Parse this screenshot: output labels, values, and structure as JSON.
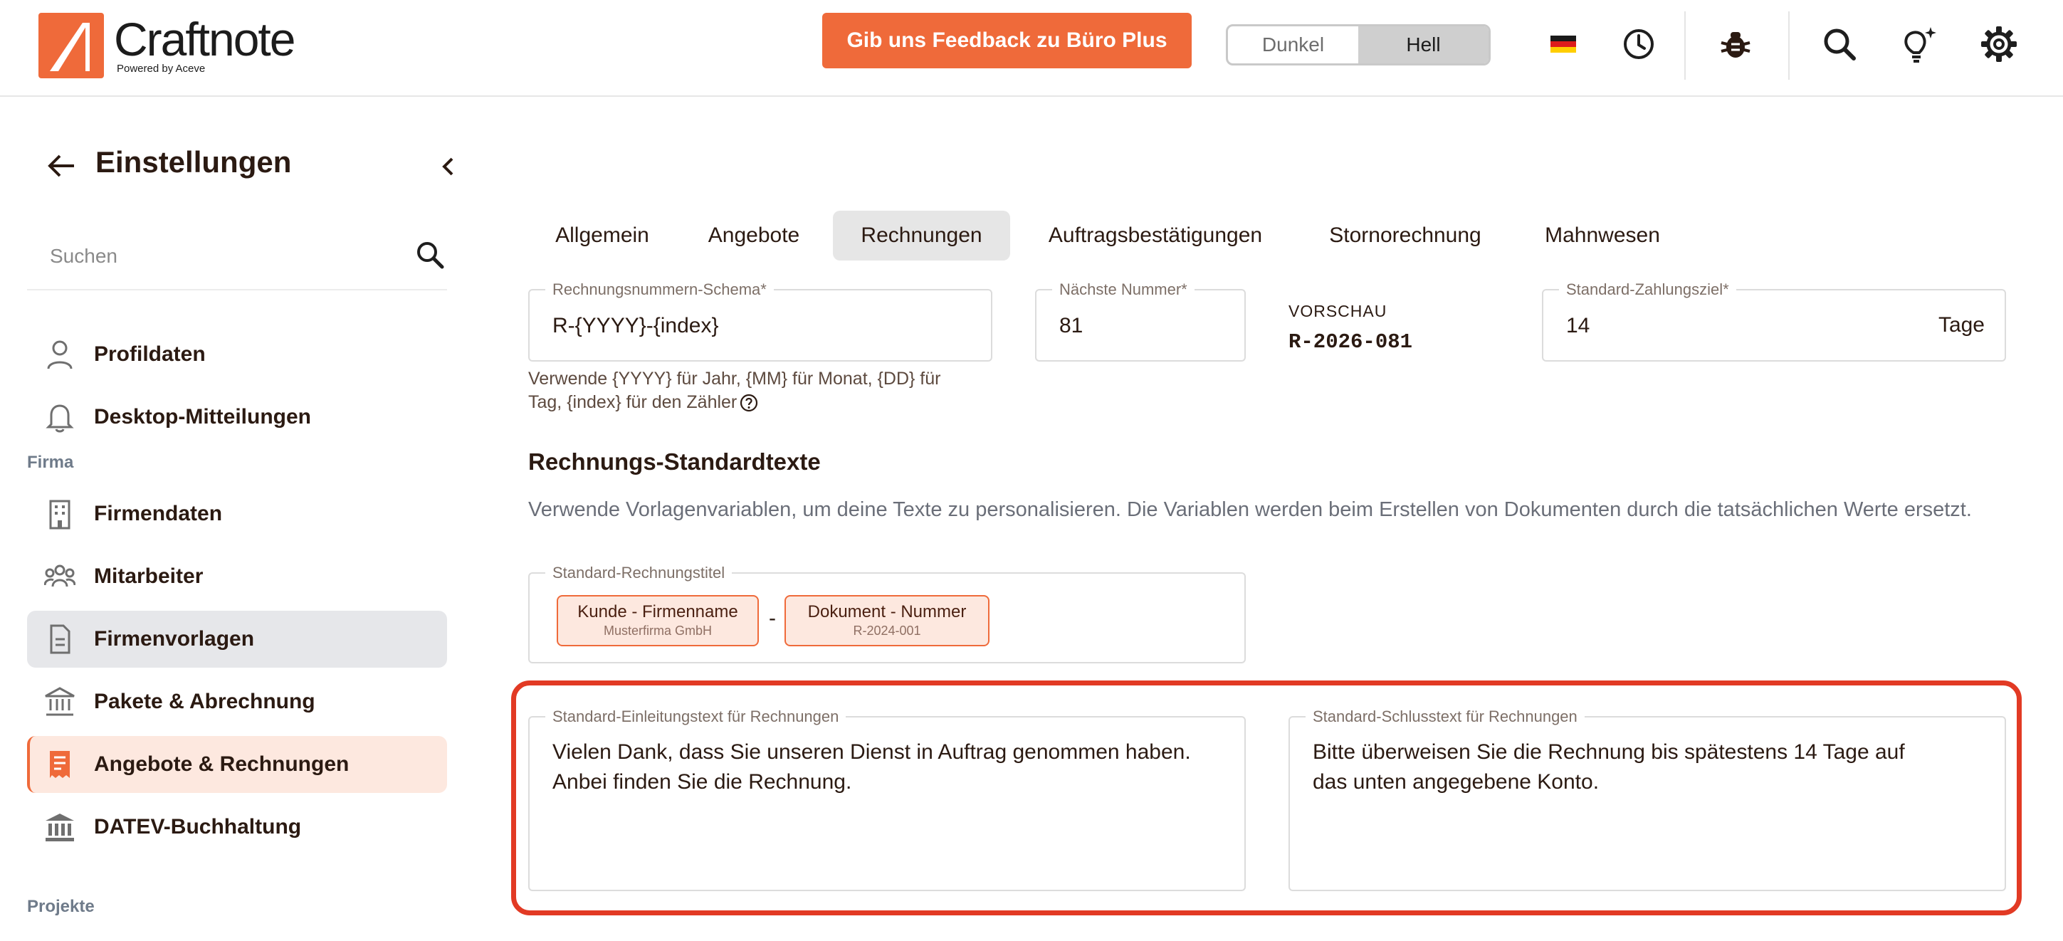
{
  "header": {
    "logo_text": "Craftnote",
    "logo_sub": "Powered by Aceve",
    "feedback_label": "Gib uns Feedback zu Büro Plus",
    "theme_options": [
      "Dunkel",
      "Hell"
    ],
    "theme_selected": "Hell",
    "icons": [
      "german-flag-icon",
      "history-clock-icon",
      "bug-icon",
      "search-icon",
      "lightbulb-icon",
      "gear-icon"
    ]
  },
  "sidebar": {
    "title": "Einstellungen",
    "search_placeholder": "Suchen",
    "items_top": [
      {
        "label": "Profildaten",
        "icon": "user-icon"
      },
      {
        "label": "Desktop-Mitteilungen",
        "icon": "bell-icon"
      }
    ],
    "section_firma": "Firma",
    "items_firma": [
      {
        "label": "Firmendaten",
        "icon": "building-icon"
      },
      {
        "label": "Mitarbeiter",
        "icon": "team-icon"
      },
      {
        "label": "Firmenvorlagen",
        "icon": "document-icon"
      },
      {
        "label": "Pakete & Abrechnung",
        "icon": "bank-icon"
      },
      {
        "label": "Angebote & Rechnungen",
        "icon": "invoice-icon"
      },
      {
        "label": "DATEV-Buchhaltung",
        "icon": "institution-icon"
      }
    ],
    "section_projekte": "Projekte",
    "active_item": "Angebote & Rechnungen",
    "selected_item": "Firmenvorlagen"
  },
  "tabs": [
    "Allgemein",
    "Angebote",
    "Rechnungen",
    "Auftragsbestätigungen",
    "Stornorechnung",
    "Mahnwesen"
  ],
  "active_tab": "Rechnungen",
  "form": {
    "schema": {
      "label": "Rechnungsnummern-Schema*",
      "value": "R-{YYYY}-{index}"
    },
    "schema_help_line1": "Verwende {YYYY} für Jahr, {MM} für Monat, {DD} für",
    "schema_help_line2": "Tag, {index} für den Zähler",
    "next_number": {
      "label": "Nächste Nummer*",
      "value": "81"
    },
    "preview": {
      "label": "VORSCHAU",
      "value": "R-2026-081"
    },
    "payment_term": {
      "label": "Standard-Zahlungsziel*",
      "value": "14",
      "unit": "Tage"
    }
  },
  "section": {
    "title": "Rechnungs-Standardtexte",
    "description": "Verwende Vorlagenvariablen, um deine Texte zu personalisieren. Die Variablen werden beim Erstellen von Dokumenten durch die tatsächlichen Werte ersetzt.",
    "title_field": {
      "label": "Standard-Rechnungstitel",
      "separator": "-",
      "chips": [
        {
          "title": "Kunde - Firmenname",
          "example": "Musterfirma GmbH"
        },
        {
          "title": "Dokument - Nummer",
          "example": "R-2024-001"
        }
      ]
    },
    "intro": {
      "label": "Standard-Einleitungstext für Rechnungen",
      "value": "Vielen Dank, dass Sie unseren Dienst in Auftrag genommen haben. Anbei finden Sie die Rechnung."
    },
    "closing": {
      "label": "Standard-Schlusstext für Rechnungen",
      "value": "Bitte überweisen Sie die Rechnung bis spätestens 14 Tage auf das unten angegebene Konto."
    }
  },
  "colors": {
    "accent": "#ef6a3a",
    "highlight": "#e23a24",
    "text": "#2b1a12",
    "chip_bg": "#fde8df"
  }
}
